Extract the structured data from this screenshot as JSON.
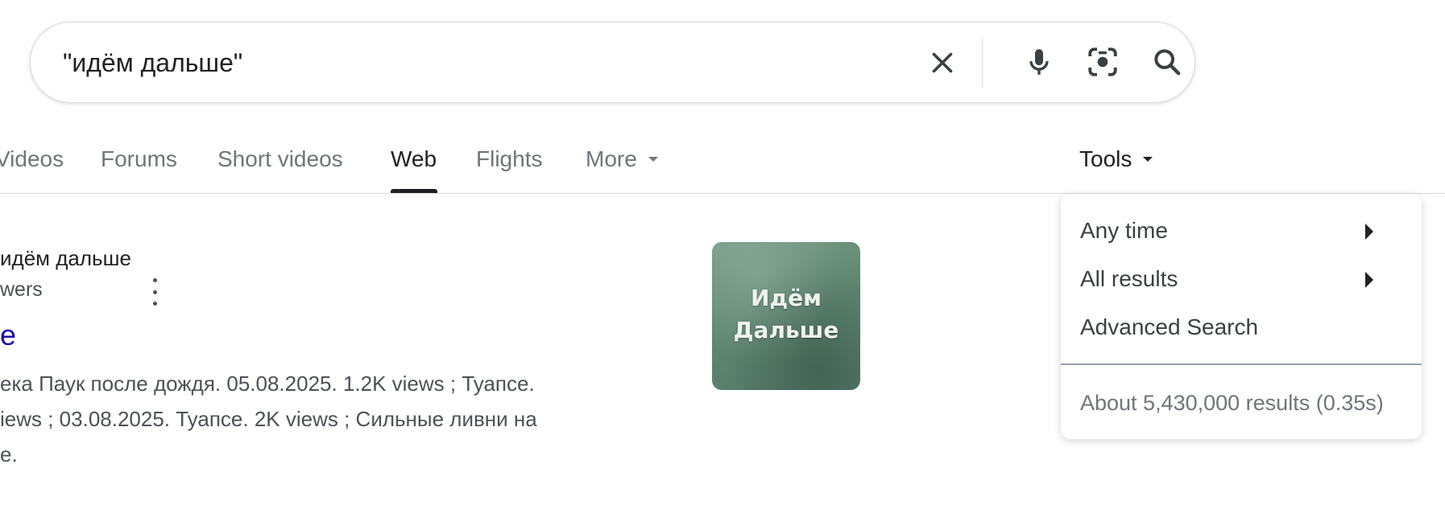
{
  "search": {
    "query": "\"идём дальше\"",
    "icons": [
      "close-icon",
      "microphone-icon",
      "camera-lens-icon",
      "search-icon"
    ]
  },
  "tabs": [
    {
      "label": "Videos",
      "active": false
    },
    {
      "label": "Forums",
      "active": false
    },
    {
      "label": "Short videos",
      "active": false
    },
    {
      "label": "Web",
      "active": true
    },
    {
      "label": "Flights",
      "active": false
    },
    {
      "label": "More",
      "active": false
    }
  ],
  "tools": {
    "label": "Tools",
    "menu": {
      "items": [
        {
          "label": "Any time",
          "has_submenu": true
        },
        {
          "label": "All results",
          "has_submenu": true
        },
        {
          "label": "Advanced Search",
          "has_submenu": false
        }
      ],
      "result_stats": "About 5,430,000 results (0.35s)"
    }
  },
  "result": {
    "site_name": "идём дальше",
    "site_meta": "wers",
    "title": "e",
    "snippet_lines": [
      "ека Паук после дождя. 05.08.2025. 1.2K views ; Туапсе.",
      "iews ; 03.08.2025. Туапсе. 2K views ; Сильные ливни на",
      "e."
    ],
    "thumbnail_text": [
      "Идём",
      "Дальше"
    ]
  },
  "colors": {
    "link": "#1a0dab",
    "active_tab": "#202124",
    "inactive_tab": "#70757a",
    "thumbnail": "#6b8f7b"
  }
}
